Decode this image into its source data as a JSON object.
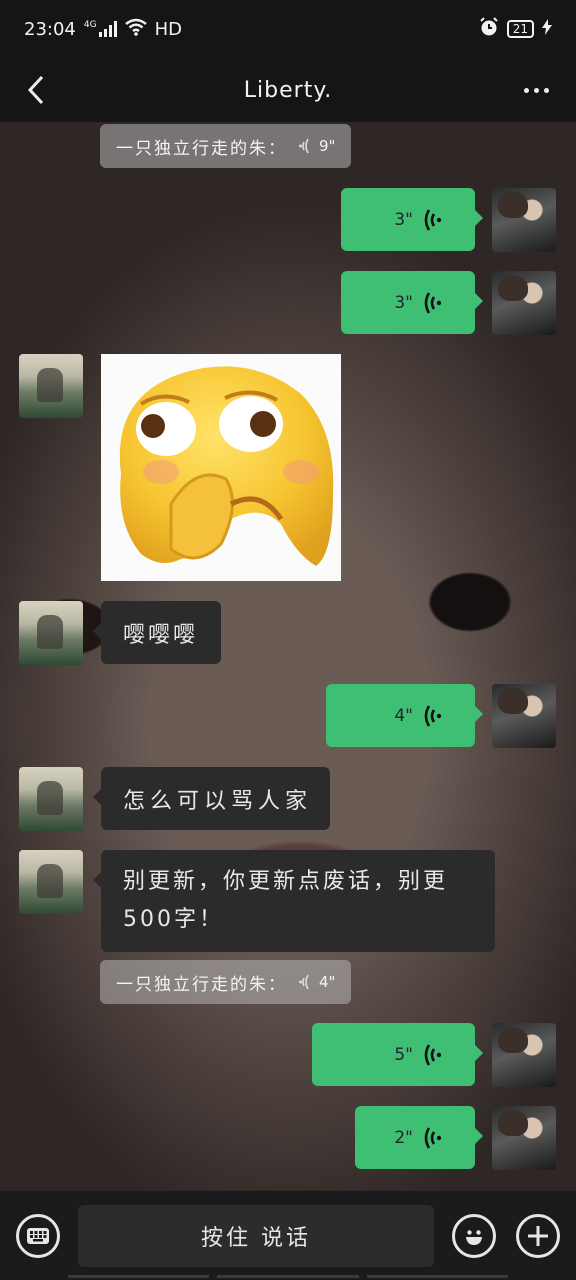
{
  "status": {
    "time": "23:04",
    "network": "4G",
    "hd": "HD",
    "battery": "21"
  },
  "header": {
    "title": "Liberty."
  },
  "messages": [
    {
      "type": "quote",
      "text": "一只独立行走的朱：",
      "duration": "9\""
    },
    {
      "type": "voice_out",
      "duration": "3\""
    },
    {
      "type": "voice_out",
      "duration": "3\""
    },
    {
      "type": "sticker_in"
    },
    {
      "type": "text_in",
      "text": "嘤嘤嘤"
    },
    {
      "type": "voice_out",
      "duration": "4\""
    },
    {
      "type": "text_in",
      "text": "怎么可以骂人家"
    },
    {
      "type": "text_in",
      "line1": "别更新，你更新点废话，别更",
      "line2": "500字！"
    },
    {
      "type": "quote",
      "text": "一只独立行走的朱：",
      "duration": "4\""
    },
    {
      "type": "voice_out",
      "duration": "5\""
    },
    {
      "type": "voice_out",
      "duration": "2\""
    }
  ],
  "input": {
    "hold_to_talk": "按住 说话"
  },
  "colors": {
    "out_bubble": "#3fbf74",
    "in_bubble": "#2b2b2b"
  }
}
